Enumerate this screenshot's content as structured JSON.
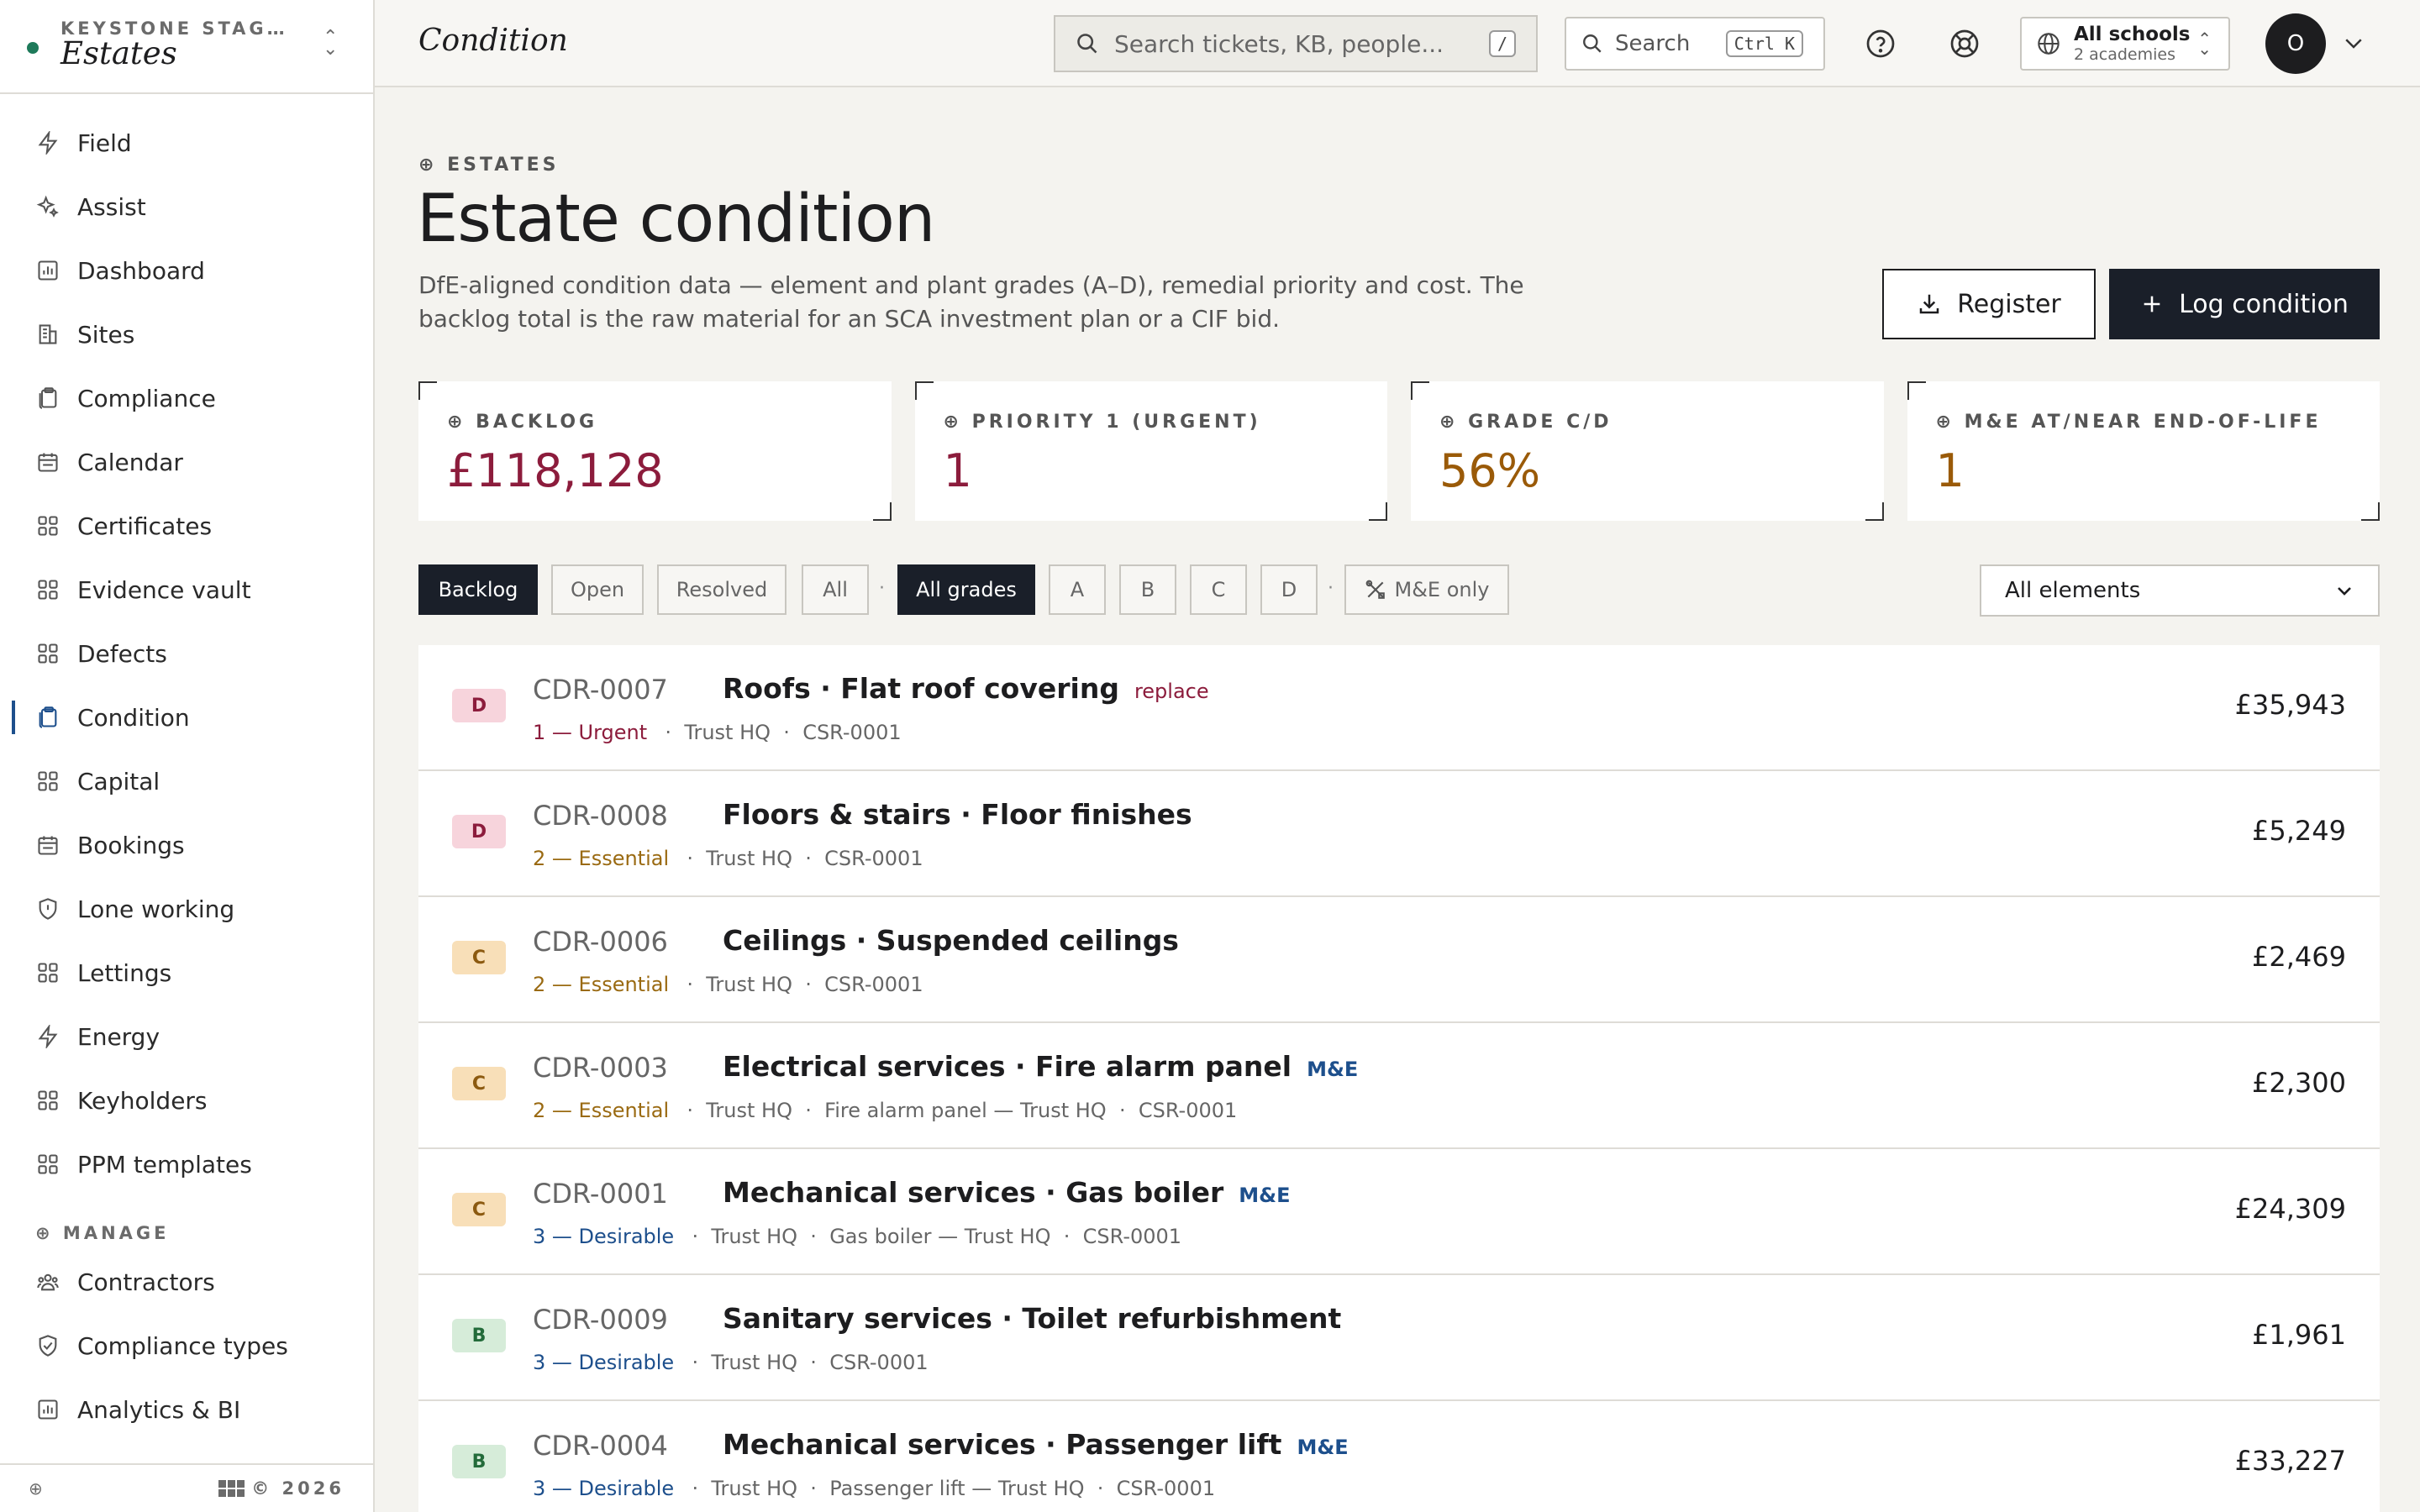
{
  "sidebar": {
    "org": "KEYSTONE STAG…",
    "app": "Estates",
    "items": [
      {
        "label": "Field",
        "icon": "bolt-icon"
      },
      {
        "label": "Assist",
        "icon": "sparkle-icon"
      },
      {
        "label": "Dashboard",
        "icon": "chart-icon"
      },
      {
        "label": "Sites",
        "icon": "building-icon"
      },
      {
        "label": "Compliance",
        "icon": "clipboard-icon"
      },
      {
        "label": "Calendar",
        "icon": "calendar-icon"
      },
      {
        "label": "Certificates",
        "icon": "grid-icon"
      },
      {
        "label": "Evidence vault",
        "icon": "grid-icon"
      },
      {
        "label": "Defects",
        "icon": "grid-icon"
      },
      {
        "label": "Condition",
        "icon": "clipboard-icon",
        "active": true
      },
      {
        "label": "Capital",
        "icon": "grid-icon"
      },
      {
        "label": "Bookings",
        "icon": "calendar-icon"
      },
      {
        "label": "Lone working",
        "icon": "shield-icon"
      },
      {
        "label": "Lettings",
        "icon": "grid-icon"
      },
      {
        "label": "Energy",
        "icon": "bolt-icon"
      },
      {
        "label": "Keyholders",
        "icon": "grid-icon"
      },
      {
        "label": "PPM templates",
        "icon": "grid-icon"
      }
    ],
    "manage_section": "MANAGE",
    "manage_items": [
      {
        "label": "Contractors",
        "icon": "people-icon"
      },
      {
        "label": "Compliance types",
        "icon": "shield-check-icon"
      },
      {
        "label": "Analytics & BI",
        "icon": "chart-icon"
      }
    ],
    "footer": "© 2026"
  },
  "topbar": {
    "title": "Condition",
    "search_placeholder": "Search tickets, KB, people...",
    "search_kbd": "/",
    "search2_placeholder": "Search",
    "search2_kbd": "Ctrl K",
    "scope_title": "All schools",
    "scope_sub": "2 academies",
    "avatar": "O"
  },
  "page": {
    "eyebrow": "ESTATES",
    "title": "Estate condition",
    "description": "DfE-aligned condition data — element and plant grades (A–D), remedial priority and cost. The backlog total is the raw material for an SCA investment plan or a CIF bid.",
    "register_label": "Register",
    "log_label": "Log condition"
  },
  "stats": [
    {
      "label": "BACKLOG",
      "value": "£118,128",
      "color": "#8c1c3c"
    },
    {
      "label": "PRIORITY 1 (URGENT)",
      "value": "1",
      "color": "#8c1c3c"
    },
    {
      "label": "GRADE C/D",
      "value": "56%",
      "color": "#9a5a08"
    },
    {
      "label": "M&E AT/NEAR END-OF-LIFE",
      "value": "1",
      "color": "#9a5a08"
    }
  ],
  "filters": {
    "status": [
      "Backlog",
      "Open",
      "Resolved",
      "All"
    ],
    "grades": [
      "All grades",
      "A",
      "B",
      "C",
      "D"
    ],
    "me_only": "M&E only",
    "element_select": "All elements"
  },
  "rows": [
    {
      "grade": "D",
      "id": "CDR-0007",
      "title": "Roofs · Flat roof covering",
      "tag": "replace",
      "priority": "1 — Urgent",
      "meta": [
        "Trust HQ",
        "CSR-0001"
      ],
      "cost": "£35,943"
    },
    {
      "grade": "D",
      "id": "CDR-0008",
      "title": "Floors & stairs · Floor finishes",
      "tag": "",
      "priority": "2 — Essential",
      "meta": [
        "Trust HQ",
        "CSR-0001"
      ],
      "cost": "£5,249"
    },
    {
      "grade": "C",
      "id": "CDR-0006",
      "title": "Ceilings · Suspended ceilings",
      "tag": "",
      "priority": "2 — Essential",
      "meta": [
        "Trust HQ",
        "CSR-0001"
      ],
      "cost": "£2,469"
    },
    {
      "grade": "C",
      "id": "CDR-0003",
      "title": "Electrical services · Fire alarm panel",
      "tag": "M&E",
      "priority": "2 — Essential",
      "meta": [
        "Trust HQ",
        "Fire alarm panel — Trust HQ",
        "CSR-0001"
      ],
      "cost": "£2,300"
    },
    {
      "grade": "C",
      "id": "CDR-0001",
      "title": "Mechanical services · Gas boiler",
      "tag": "M&E",
      "priority": "3 — Desirable",
      "meta": [
        "Trust HQ",
        "Gas boiler — Trust HQ",
        "CSR-0001"
      ],
      "cost": "£24,309"
    },
    {
      "grade": "B",
      "id": "CDR-0009",
      "title": "Sanitary services · Toilet refurbishment",
      "tag": "",
      "priority": "3 — Desirable",
      "meta": [
        "Trust HQ",
        "CSR-0001"
      ],
      "cost": "£1,961"
    },
    {
      "grade": "B",
      "id": "CDR-0004",
      "title": "Mechanical services · Passenger lift",
      "tag": "M&E",
      "priority": "3 — Desirable",
      "meta": [
        "Trust HQ",
        "Passenger lift — Trust HQ",
        "CSR-0001"
      ],
      "cost": "£33,227"
    }
  ]
}
